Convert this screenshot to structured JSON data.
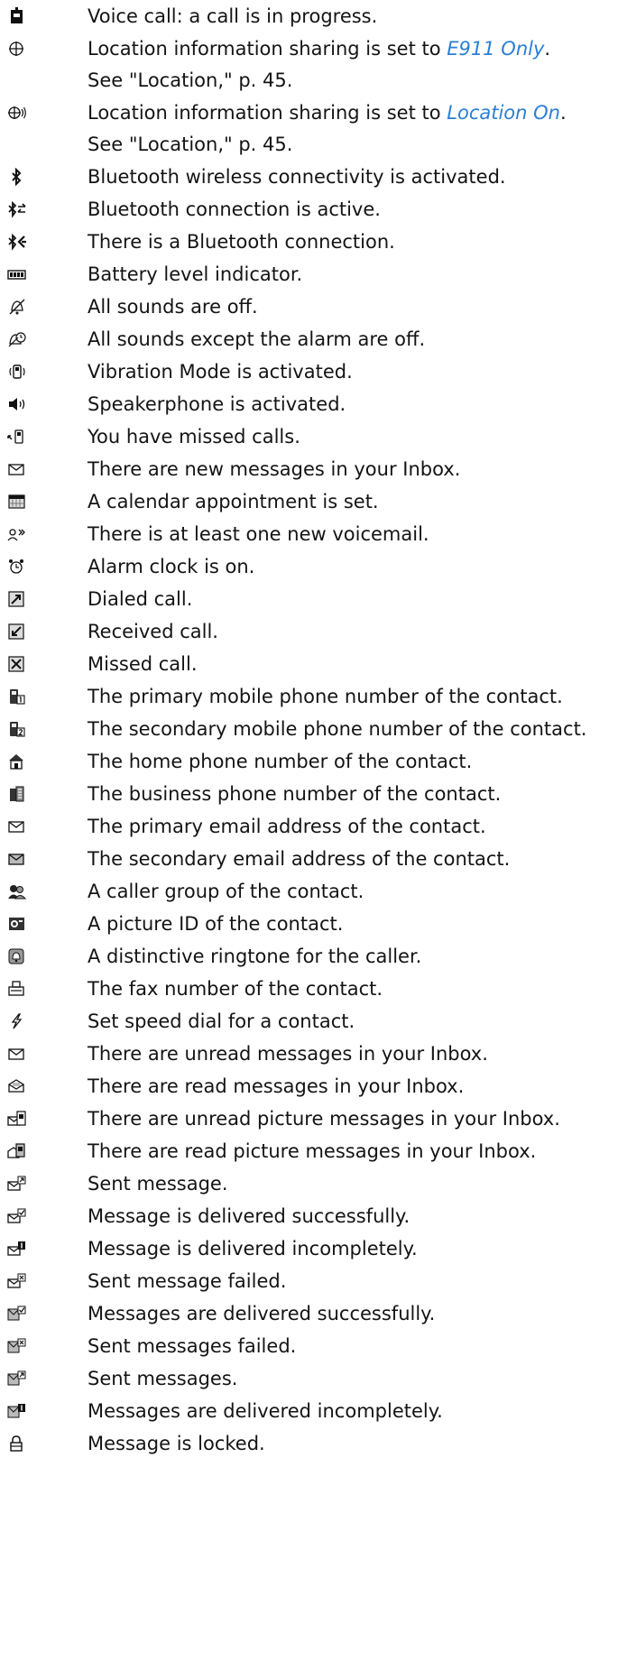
{
  "colors": {
    "text": "#141414",
    "link": "#2a7fd6"
  },
  "rows": [
    {
      "icon": "voice-call-icon",
      "text": "Voice call: a call is in progress."
    },
    {
      "icon": "location-e911-icon",
      "pre": "Location information sharing is set to ",
      "link": "E911 Only",
      "post": "."
    },
    {
      "cont": true,
      "text": "See \"Location,\" p. 45."
    },
    {
      "icon": "location-on-icon",
      "pre": "Location information sharing is set to ",
      "link": "Location On",
      "post": "."
    },
    {
      "cont": true,
      "text": "See \"Location,\" p. 45."
    },
    {
      "icon": "bluetooth-icon",
      "text": "Bluetooth wireless connectivity is activated."
    },
    {
      "icon": "bluetooth-active-icon",
      "text": "Bluetooth connection is active."
    },
    {
      "icon": "bluetooth-connection-icon",
      "text": "There is a Bluetooth connection."
    },
    {
      "icon": "battery-icon",
      "text": "Battery level indicator."
    },
    {
      "icon": "silent-icon",
      "text": "All sounds are off."
    },
    {
      "icon": "alarm-only-icon",
      "text": "All sounds except the alarm are off."
    },
    {
      "icon": "vibration-icon",
      "text": "Vibration Mode is activated."
    },
    {
      "icon": "speakerphone-icon",
      "text": "Speakerphone is activated."
    },
    {
      "icon": "missed-calls-icon",
      "text": "You have missed calls."
    },
    {
      "icon": "new-message-icon",
      "text": "There are new messages in your Inbox."
    },
    {
      "icon": "calendar-icon",
      "text": "A calendar appointment is set."
    },
    {
      "icon": "voicemail-icon",
      "text": "There is at least one new voicemail."
    },
    {
      "icon": "alarm-clock-icon",
      "text": "Alarm clock is on."
    },
    {
      "icon": "dialed-call-icon",
      "text": "Dialed call."
    },
    {
      "icon": "received-call-icon",
      "text": "Received call."
    },
    {
      "icon": "missed-call-icon",
      "text": "Missed call."
    },
    {
      "icon": "primary-mobile-icon",
      "text": "The primary mobile phone number of the contact."
    },
    {
      "icon": "secondary-mobile-icon",
      "text": "The secondary mobile phone number of the contact."
    },
    {
      "icon": "home-phone-icon",
      "text": "The home phone number of the contact."
    },
    {
      "icon": "business-phone-icon",
      "text": "The business phone number of the contact."
    },
    {
      "icon": "primary-email-icon",
      "text": "The primary email address of the contact."
    },
    {
      "icon": "secondary-email-icon",
      "text": "The secondary email address of the contact."
    },
    {
      "icon": "caller-group-icon",
      "text": "A caller group of the contact."
    },
    {
      "icon": "picture-id-icon",
      "text": "A picture ID of the contact."
    },
    {
      "icon": "ringtone-icon",
      "text": "A distinctive ringtone for the caller."
    },
    {
      "icon": "fax-icon",
      "text": "The fax number of the contact."
    },
    {
      "icon": "speed-dial-icon",
      "text": "Set speed dial for a contact."
    },
    {
      "icon": "unread-message-icon",
      "text": "There are unread messages in your Inbox."
    },
    {
      "icon": "read-message-icon",
      "text": "There are read messages in your Inbox."
    },
    {
      "icon": "unread-picture-message-icon",
      "text": "There are unread picture messages in your Inbox."
    },
    {
      "icon": "read-picture-message-icon",
      "text": "There are read picture messages in your Inbox."
    },
    {
      "icon": "sent-message-icon",
      "text": "Sent message."
    },
    {
      "icon": "delivered-message-icon",
      "text": "Message is delivered successfully."
    },
    {
      "icon": "delivered-incomplete-icon",
      "text": "Message is delivered incompletely."
    },
    {
      "icon": "sent-failed-icon",
      "text": "Sent message failed."
    },
    {
      "icon": "messages-delivered-icon",
      "text": "Messages are delivered successfully."
    },
    {
      "icon": "messages-failed-icon",
      "text": "Sent messages failed."
    },
    {
      "icon": "messages-sent-icon",
      "text": "Sent messages."
    },
    {
      "icon": "messages-incomplete-icon",
      "text": "Messages are delivered incompletely."
    },
    {
      "icon": "locked-message-icon",
      "text": "Message is locked."
    }
  ]
}
